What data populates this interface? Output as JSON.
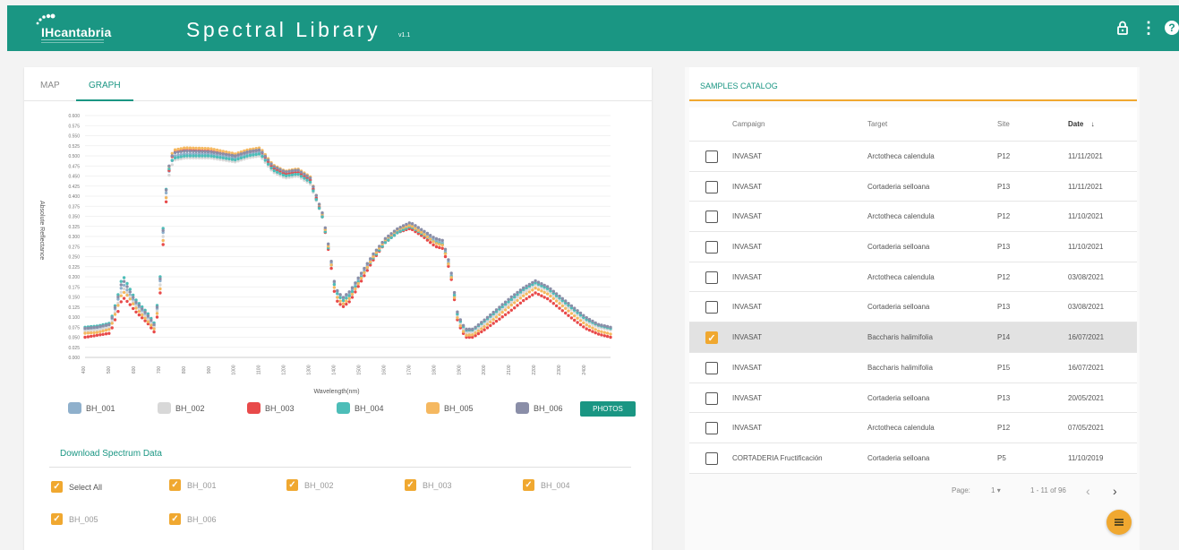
{
  "header": {
    "logo_text": "IHcantabria",
    "title": "Spectral Library",
    "version": "v1.1",
    "icons": [
      "lock-icon",
      "more-vert-icon",
      "help-icon"
    ],
    "accent": "#1a9683"
  },
  "tabs": [
    {
      "label": "MAP",
      "active": false
    },
    {
      "label": "GRAPH",
      "active": true
    }
  ],
  "chart_data": {
    "type": "scatter",
    "title": "",
    "xlabel": "Wavelength(nm)",
    "ylabel": "Absolute Reflectance",
    "xlim": [
      400,
      2500
    ],
    "ylim": [
      0,
      0.6
    ],
    "x_ticks": [
      400,
      500,
      600,
      700,
      800,
      900,
      1000,
      1100,
      1200,
      1300,
      1400,
      1500,
      1600,
      1700,
      1800,
      1900,
      2000,
      2100,
      2200,
      2300,
      2400
    ],
    "y_ticks": [
      0.0,
      0.025,
      0.05,
      0.075,
      0.1,
      0.125,
      0.15,
      0.175,
      0.2,
      0.225,
      0.25,
      0.275,
      0.3,
      0.325,
      0.35,
      0.375,
      0.4,
      0.425,
      0.45,
      0.475,
      0.5,
      0.525,
      0.55,
      0.575,
      0.6
    ],
    "grid": true,
    "x": [
      400,
      450,
      500,
      530,
      550,
      575,
      600,
      650,
      680,
      700,
      720,
      740,
      760,
      800,
      900,
      1000,
      1050,
      1100,
      1150,
      1200,
      1250,
      1300,
      1350,
      1380,
      1400,
      1430,
      1460,
      1500,
      1550,
      1600,
      1650,
      1700,
      1750,
      1800,
      1830,
      1860,
      1890,
      1920,
      1950,
      2000,
      2100,
      2150,
      2200,
      2250,
      2300,
      2350,
      2400,
      2450,
      2500
    ],
    "series": [
      {
        "name": "BH_001",
        "color": "#8fb0cc",
        "values": [
          0.07,
          0.072,
          0.08,
          0.14,
          0.185,
          0.16,
          0.135,
          0.1,
          0.075,
          0.19,
          0.39,
          0.48,
          0.5,
          0.505,
          0.505,
          0.495,
          0.505,
          0.51,
          0.47,
          0.455,
          0.46,
          0.44,
          0.35,
          0.25,
          0.17,
          0.145,
          0.16,
          0.2,
          0.25,
          0.29,
          0.315,
          0.33,
          0.31,
          0.29,
          0.285,
          0.22,
          0.1,
          0.065,
          0.065,
          0.09,
          0.14,
          0.165,
          0.185,
          0.17,
          0.145,
          0.12,
          0.095,
          0.078,
          0.07
        ]
      },
      {
        "name": "BH_002",
        "color": "#d8d8d8",
        "values": [
          0.065,
          0.068,
          0.075,
          0.13,
          0.175,
          0.155,
          0.13,
          0.095,
          0.072,
          0.18,
          0.38,
          0.47,
          0.49,
          0.495,
          0.495,
          0.485,
          0.495,
          0.5,
          0.46,
          0.445,
          0.45,
          0.43,
          0.345,
          0.245,
          0.165,
          0.14,
          0.155,
          0.195,
          0.245,
          0.285,
          0.31,
          0.325,
          0.305,
          0.285,
          0.28,
          0.215,
          0.095,
          0.06,
          0.062,
          0.085,
          0.135,
          0.16,
          0.18,
          0.165,
          0.14,
          0.115,
          0.09,
          0.075,
          0.068
        ]
      },
      {
        "name": "BH_003",
        "color": "#e84a4a",
        "values": [
          0.05,
          0.055,
          0.06,
          0.11,
          0.15,
          0.135,
          0.115,
          0.085,
          0.06,
          0.16,
          0.36,
          0.49,
          0.51,
          0.515,
          0.512,
          0.5,
          0.51,
          0.515,
          0.47,
          0.455,
          0.46,
          0.44,
          0.345,
          0.24,
          0.145,
          0.125,
          0.14,
          0.185,
          0.24,
          0.285,
          0.31,
          0.32,
          0.3,
          0.275,
          0.27,
          0.21,
          0.085,
          0.05,
          0.05,
          0.07,
          0.115,
          0.14,
          0.16,
          0.145,
          0.12,
          0.095,
          0.072,
          0.058,
          0.05
        ]
      },
      {
        "name": "BH_004",
        "color": "#4dbdb8",
        "values": [
          0.075,
          0.078,
          0.085,
          0.15,
          0.205,
          0.175,
          0.145,
          0.11,
          0.082,
          0.2,
          0.4,
          0.485,
          0.495,
          0.5,
          0.5,
          0.49,
          0.5,
          0.505,
          0.465,
          0.45,
          0.455,
          0.435,
          0.345,
          0.245,
          0.165,
          0.14,
          0.155,
          0.195,
          0.245,
          0.285,
          0.31,
          0.325,
          0.305,
          0.285,
          0.28,
          0.215,
          0.1,
          0.068,
          0.068,
          0.092,
          0.142,
          0.168,
          0.185,
          0.17,
          0.145,
          0.12,
          0.095,
          0.08,
          0.072
        ]
      },
      {
        "name": "BH_005",
        "color": "#f5b860",
        "values": [
          0.06,
          0.062,
          0.07,
          0.125,
          0.165,
          0.15,
          0.125,
          0.09,
          0.068,
          0.17,
          0.37,
          0.5,
          0.515,
          0.52,
          0.518,
          0.505,
          0.515,
          0.52,
          0.478,
          0.462,
          0.468,
          0.448,
          0.352,
          0.248,
          0.155,
          0.132,
          0.148,
          0.192,
          0.248,
          0.292,
          0.318,
          0.328,
          0.308,
          0.283,
          0.278,
          0.215,
          0.09,
          0.055,
          0.056,
          0.078,
          0.128,
          0.152,
          0.172,
          0.157,
          0.132,
          0.106,
          0.082,
          0.066,
          0.058
        ]
      },
      {
        "name": "BH_006",
        "color": "#8a8ea8",
        "values": [
          0.072,
          0.075,
          0.082,
          0.145,
          0.195,
          0.168,
          0.14,
          0.105,
          0.078,
          0.195,
          0.395,
          0.495,
          0.508,
          0.512,
          0.51,
          0.5,
          0.51,
          0.515,
          0.475,
          0.46,
          0.465,
          0.445,
          0.355,
          0.255,
          0.172,
          0.148,
          0.165,
          0.205,
          0.255,
          0.295,
          0.32,
          0.335,
          0.315,
          0.295,
          0.29,
          0.225,
          0.105,
          0.07,
          0.07,
          0.095,
          0.148,
          0.172,
          0.19,
          0.175,
          0.15,
          0.125,
          0.1,
          0.082,
          0.075
        ]
      }
    ]
  },
  "legend_labels": [
    "BH_001",
    "BH_002",
    "BH_003",
    "BH_004",
    "BH_005",
    "BH_006"
  ],
  "photos_button": "PHOTOS",
  "download": {
    "title": "Download Spectrum Data",
    "select_all": "Select All",
    "items": [
      "BH_001",
      "BH_002",
      "BH_003",
      "BH_004",
      "BH_005",
      "BH_006"
    ]
  },
  "catalog": {
    "title": "SAMPLES CATALOG",
    "columns": [
      "Campaign",
      "Target",
      "Site",
      "Date"
    ],
    "rows": [
      {
        "campaign": "INVASAT",
        "target": "Arctotheca calendula",
        "site": "P12",
        "date": "11/11/2021",
        "checked": false
      },
      {
        "campaign": "INVASAT",
        "target": "Cortaderia selloana",
        "site": "P13",
        "date": "11/11/2021",
        "checked": false
      },
      {
        "campaign": "INVASAT",
        "target": "Arctotheca calendula",
        "site": "P12",
        "date": "11/10/2021",
        "checked": false
      },
      {
        "campaign": "INVASAT",
        "target": "Cortaderia selloana",
        "site": "P13",
        "date": "11/10/2021",
        "checked": false
      },
      {
        "campaign": "INVASAT",
        "target": "Arctotheca calendula",
        "site": "P12",
        "date": "03/08/2021",
        "checked": false
      },
      {
        "campaign": "INVASAT",
        "target": "Cortaderia selloana",
        "site": "P13",
        "date": "03/08/2021",
        "checked": false
      },
      {
        "campaign": "INVASAT",
        "target": "Baccharis halimifolia",
        "site": "P14",
        "date": "16/07/2021",
        "checked": true
      },
      {
        "campaign": "INVASAT",
        "target": "Baccharis halimifolia",
        "site": "P15",
        "date": "16/07/2021",
        "checked": false
      },
      {
        "campaign": "INVASAT",
        "target": "Cortaderia selloana",
        "site": "P13",
        "date": "20/05/2021",
        "checked": false
      },
      {
        "campaign": "INVASAT",
        "target": "Arctotheca calendula",
        "site": "P12",
        "date": "07/05/2021",
        "checked": false
      },
      {
        "campaign": "CORTADERIA Fructificación",
        "target": "Cortaderia selloana",
        "site": "P5",
        "date": "11/10/2019",
        "checked": false
      }
    ],
    "pager": {
      "label": "Page:",
      "page": "1",
      "range": "1 - 11 of 96"
    }
  },
  "fab_icon": "notes-icon"
}
